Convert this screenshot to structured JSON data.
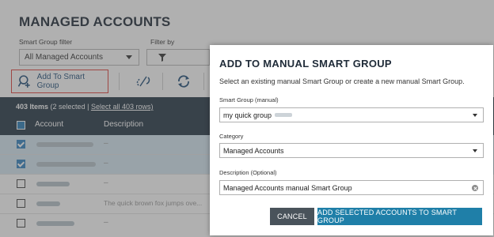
{
  "page": {
    "title": "MANAGED ACCOUNTS",
    "smart_group_filter_label": "Smart Group filter",
    "smart_group_filter_value": "All Managed Accounts",
    "filter_by_label": "Filter by"
  },
  "toolbar": {
    "add_to_smart_group_label": "Add To Smart Group",
    "icons": [
      "add-group-icon",
      "unlink-icon",
      "refresh-icon"
    ]
  },
  "grid": {
    "item_count": "403 Items",
    "selected_text": "(2 selected |",
    "select_all_link": "Select all 403 rows)",
    "columns": [
      "Account",
      "Description"
    ],
    "rows": [
      {
        "selected": true,
        "description": "–"
      },
      {
        "selected": true,
        "description": "–"
      },
      {
        "selected": false,
        "description": "–"
      },
      {
        "selected": false,
        "description": "The quick brown fox jumps ove..."
      },
      {
        "selected": false,
        "description": "–"
      }
    ]
  },
  "dialog": {
    "title": "ADD TO MANUAL SMART GROUP",
    "subtitle": "Select an existing manual Smart Group or create a new manual Smart Group.",
    "smart_group_label": "Smart Group (manual)",
    "smart_group_value": "my quick group",
    "category_label": "Category",
    "category_value": "Managed Accounts",
    "description_label": "Description (Optional)",
    "description_value": "Managed Accounts manual Smart Group",
    "cancel_label": "CANCEL",
    "add_label": "ADD SELECTED ACCOUNTS TO SMART GROUP"
  },
  "colors": {
    "header_bg": "#253746",
    "primary_button": "#1f7fa8",
    "cancel_button": "#49535b",
    "highlight_border": "#e0413b",
    "selected_row": "#d6e8f2"
  }
}
